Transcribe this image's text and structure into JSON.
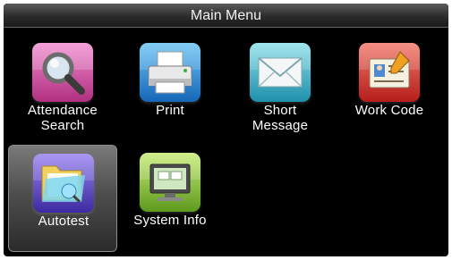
{
  "header": {
    "title": "Main Menu"
  },
  "menu": {
    "items": [
      {
        "label": "Attendance Search",
        "icon": "magnifier-icon",
        "color": "#d35aa8"
      },
      {
        "label": "Print",
        "icon": "printer-icon",
        "color": "#2f8ed8"
      },
      {
        "label": "Short Message",
        "icon": "envelope-icon",
        "color": "#3fb0c8"
      },
      {
        "label": "Work Code",
        "icon": "id-card-icon",
        "color": "#d8322c"
      },
      {
        "label": "Autotest",
        "icon": "folder-icon",
        "color": "#6a4fc8",
        "selected": true
      },
      {
        "label": "System Info",
        "icon": "computer-icon",
        "color": "#8cc63e"
      }
    ]
  }
}
